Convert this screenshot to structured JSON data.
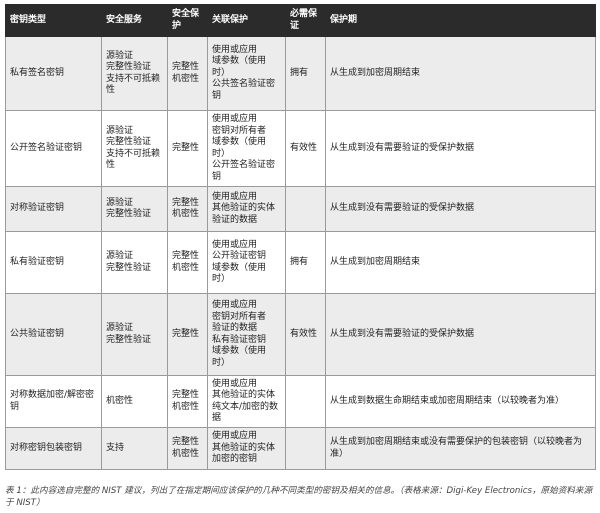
{
  "headers": [
    "密钥类型",
    "安全服务",
    "安全保护",
    "关联保护",
    "必需保证",
    "保护期"
  ],
  "rows": [
    {
      "type": "私有签名密钥",
      "services": [
        "源验证",
        "完整性验证",
        "支持不可抵赖",
        "性"
      ],
      "protection": [
        "完整性",
        "机密性"
      ],
      "associated": [
        "使用或应用",
        "域参数（使用",
        "时）",
        "公共签名验证密",
        "钥"
      ],
      "assurance": "拥有",
      "period": "从生成到加密周期结束"
    },
    {
      "type": "公开签名验证密钥",
      "services": [
        "源验证",
        "完整性验证",
        "支持不可抵赖",
        "性"
      ],
      "protection": [
        "完整性"
      ],
      "associated": [
        "使用或应用",
        "密钥对所有者",
        "域参数（使用",
        "时）",
        "公开签名验证密",
        "钥"
      ],
      "assurance": "有效性",
      "period": "从生成到没有需要验证的受保护数据"
    },
    {
      "type": "对称验证密钥",
      "services": [
        "源验证",
        "完整性验证"
      ],
      "protection": [
        "完整性",
        "机密性"
      ],
      "associated": [
        "使用或应用",
        "其他验证的实体",
        "验证的数据"
      ],
      "assurance": "",
      "period": "从生成到没有需要验证的受保护数据"
    },
    {
      "type": "私有验证密钥",
      "services": [
        "源验证",
        "完整性验证"
      ],
      "protection": [
        "完整性",
        "机密性"
      ],
      "associated": [
        "使用或应用",
        "公开验证密钥",
        "域参数（使用",
        "时）"
      ],
      "assurance": "拥有",
      "period": "从生成到加密周期结束"
    },
    {
      "type": "公共验证密钥",
      "services": [
        "源验证",
        "完整性验证"
      ],
      "protection": [
        "完整性"
      ],
      "associated": [
        "使用或应用",
        "密钥对所有者",
        "验证的数据",
        "私有验证密钥",
        "域参数（使用",
        "时）"
      ],
      "assurance": "有效性",
      "period": "从生成到没有需要验证的受保护数据"
    },
    {
      "type": "对称数据加密/解密密钥",
      "services": [
        "机密性"
      ],
      "protection": [
        "完整性",
        "机密性"
      ],
      "associated": [
        "使用或应用",
        "其他验证的实体",
        "纯文本/加密的数",
        "据"
      ],
      "assurance": "",
      "period": "从生成到数据生命期结束或加密周期结束（以较晚者为准）"
    },
    {
      "type": "对称密钥包装密钥",
      "services": [
        "支持"
      ],
      "protection": [
        "完整性",
        "机密性"
      ],
      "associated": [
        "使用或应用",
        "其他验证的实体",
        "加密的密钥"
      ],
      "assurance": "",
      "period": "从生成到加密周期结束或没有需要保护的包装密钥（以较晚者为准）"
    }
  ],
  "caption": "表 1：此内容选自完整的 NIST 建议，列出了在指定期间应该保护的几种不同类型的密钥及相关的信息。（表格来源：Digi-Key Electronics，原始资料来源于 NIST）"
}
